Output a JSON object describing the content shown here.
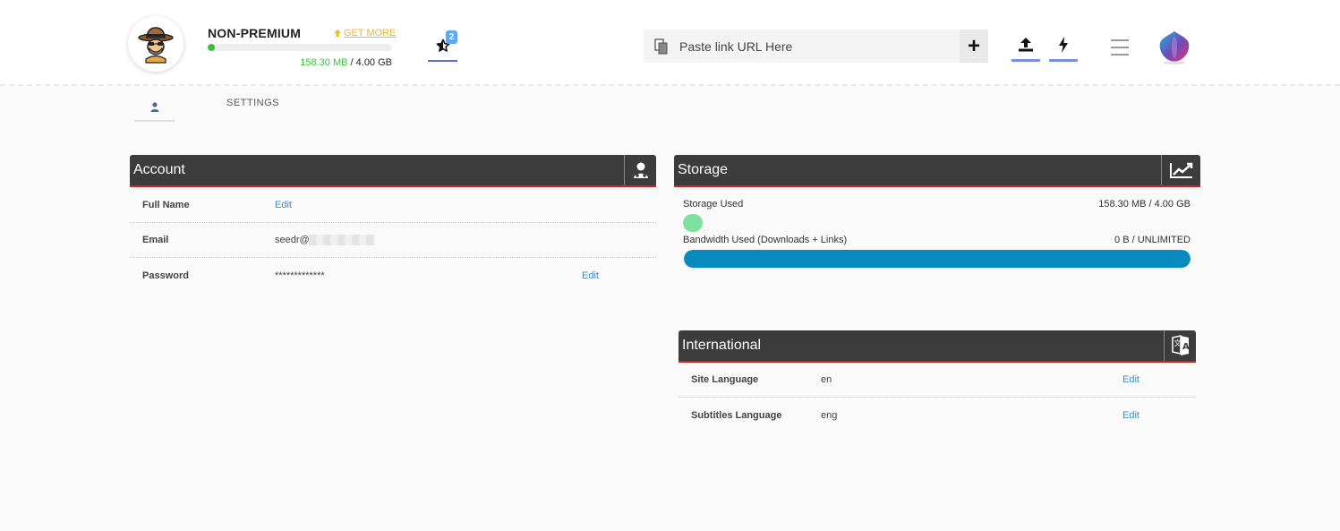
{
  "header": {
    "plan": "NON-PREMIUM",
    "get_more": "GET MORE",
    "usage_used": "158.30 MB",
    "usage_sep": " / ",
    "usage_total": "4.00 GB",
    "usage_fraction": 0.0387,
    "notifications_count": "2",
    "url_placeholder": "Paste link URL Here",
    "add_label": "+"
  },
  "tabs": {
    "settings": "SETTINGS"
  },
  "account": {
    "title": "Account",
    "rows": [
      {
        "label": "Full Name",
        "value": "",
        "edit": "Edit"
      },
      {
        "label": "Email",
        "value": "seedr@",
        "edit": ""
      },
      {
        "label": "Password",
        "value": "*************",
        "edit": "Edit"
      }
    ]
  },
  "storage": {
    "title": "Storage",
    "storage_used_label": "Storage Used",
    "storage_used_value": "158.30 MB / 4.00 GB",
    "storage_fraction": 0.0387,
    "bandwidth_label": "Bandwidth Used (Downloads + Links)",
    "bandwidth_value": "0 B / UNLIMITED",
    "bandwidth_fraction": 1.0
  },
  "international": {
    "title": "International",
    "rows": [
      {
        "label": "Site Language",
        "value": "en",
        "edit": "Edit"
      },
      {
        "label": "Subtitles Language",
        "value": "eng",
        "edit": "Edit"
      }
    ]
  },
  "colors": {
    "accent_green": "#3cc13b",
    "accent_blue": "#0a8bbf",
    "header_dark": "#3c3c3c",
    "header_red": "#cc2222",
    "link_blue": "#3a8cc8",
    "get_more_yellow": "#f0b429"
  }
}
